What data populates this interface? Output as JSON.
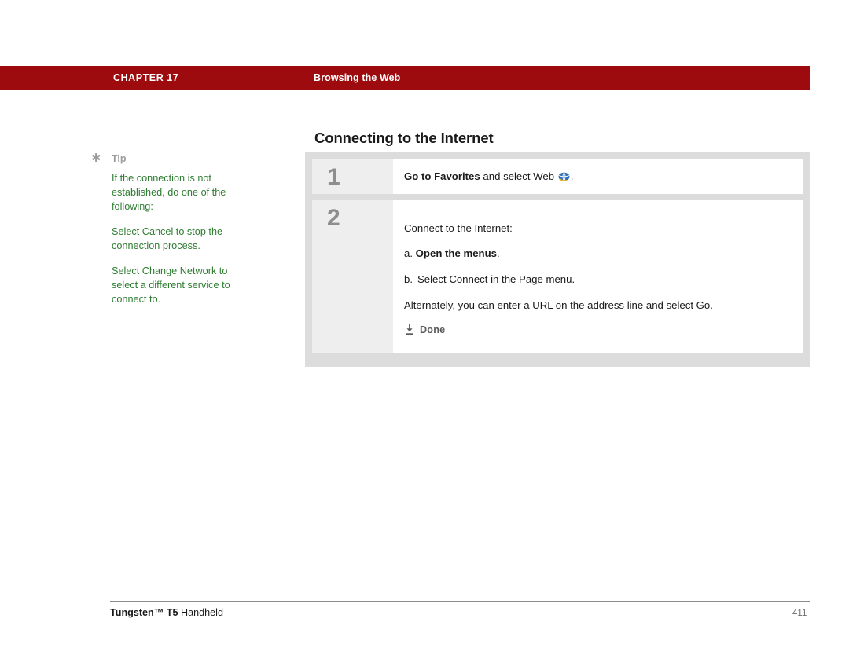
{
  "header": {
    "chapter": "CHAPTER 17",
    "section": "Browsing the Web",
    "bar_color": "#9e0b0f"
  },
  "page_title": "Connecting to the Internet",
  "tip": {
    "label": "Tip",
    "icon": "asterisk-icon",
    "color": "#2f7d32",
    "paragraphs": [
      "If the connection is not established, do one of the following:",
      "Select Cancel to stop the connection process.",
      "Select Change Network to select a different service to connect to."
    ]
  },
  "steps": [
    {
      "number": "1",
      "lead_bold": "Go to Favorites",
      "rest": " and select Web ",
      "icon": "web-globe-icon",
      "trailing": "."
    },
    {
      "number": "2",
      "intro": "Connect to the Internet:",
      "substeps": [
        {
          "letter": "a.",
          "bold_text": "Open the menus",
          "trailing": "."
        },
        {
          "letter": "b.",
          "text": "Select Connect in the Page menu."
        }
      ],
      "alternate": "Alternately, you can enter a URL on the address line and select Go.",
      "done_label": "Done",
      "done_icon": "down-arrow-done-icon"
    }
  ],
  "footer": {
    "product_bold": "Tungsten™ T5",
    "product_rest": " Handheld",
    "page_number": "411"
  }
}
